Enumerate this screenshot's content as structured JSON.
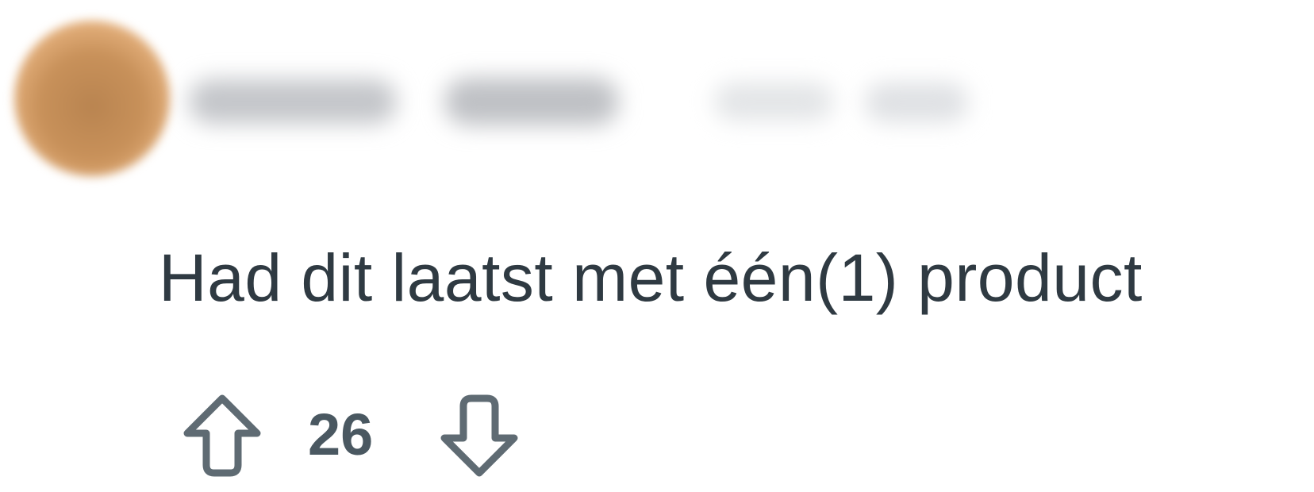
{
  "comment": {
    "author": {
      "avatar_icon": "avatar-blurred",
      "avatar_color": "#c8915a"
    },
    "body": "Had dit laatst met één(1) product",
    "votes": {
      "upvote_icon": "arrow-up-outline-icon",
      "score": "26",
      "downvote_icon": "arrow-down-outline-icon",
      "icon_color": "#5f6b73"
    },
    "text_color": "#2f3a42"
  }
}
